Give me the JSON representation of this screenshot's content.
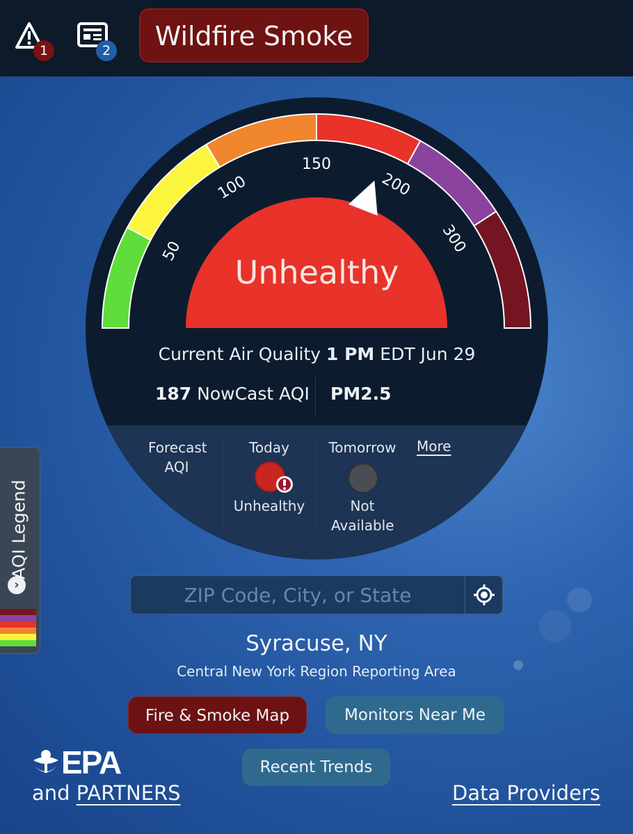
{
  "topbar": {
    "alerts_badge": "1",
    "notices_badge": "2",
    "wildfire_button": "Wildfire Smoke"
  },
  "gauge": {
    "tick_labels": [
      "50",
      "100",
      "150",
      "200",
      "300"
    ],
    "aqi_value": 187,
    "category": "Unhealthy",
    "category_color": "#e8322a",
    "segment_colors": [
      "#5fdd3b",
      "#fbf53d",
      "#f0862e",
      "#e8322a",
      "#8b43a0",
      "#751522"
    ]
  },
  "current": {
    "prefix": "Current Air Quality",
    "time": "1 PM",
    "tz_date": "EDT Jun 29",
    "aqi_number": "187",
    "aqi_label": "NowCast AQI",
    "pollutant": "PM2.5"
  },
  "forecast": {
    "label": "Forecast AQI",
    "today_label": "Today",
    "today_status": "Unhealthy",
    "tomorrow_label": "Tomorrow",
    "tomorrow_status": "Not Available",
    "more": "More"
  },
  "legend": {
    "tab_label": "AQI Legend"
  },
  "search": {
    "placeholder": "ZIP Code, City, or State"
  },
  "location": {
    "city": "Syracuse, NY",
    "region": "Central New York Region Reporting Area"
  },
  "buttons": {
    "fire_map": "Fire & Smoke Map",
    "monitors": "Monitors Near Me",
    "trends": "Recent Trends"
  },
  "footer": {
    "epa": "EPA",
    "and": "and",
    "partners": "PARTNERS",
    "data_providers": "Data Providers"
  }
}
